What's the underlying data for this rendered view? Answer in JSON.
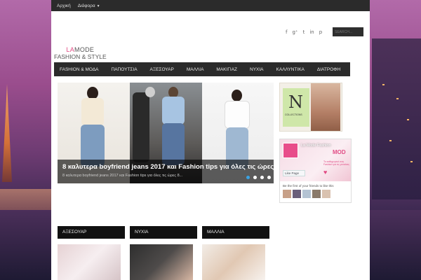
{
  "topbar": {
    "items": [
      "Αρχική",
      "Διάφορα"
    ]
  },
  "header": {
    "logo_line1_a": "LA",
    "logo_line1_b": "MODE",
    "logo_line2": "FASHION & STYLE",
    "social_icons": [
      "facebook-icon",
      "google-plus-icon",
      "twitter-icon",
      "linkedin-icon",
      "pinterest-icon"
    ],
    "social_glyphs": [
      "f",
      "g⁺",
      "t",
      "in",
      "p"
    ],
    "search_placeholder": "SEARCH..."
  },
  "nav": {
    "items": [
      "FASHION & ΜΟΔΑ",
      "ΠΑΠΟΥΤΣΙΑ",
      "ΑΞΕΣΟΥΑΡ",
      "ΜΑΛΛΙΑ",
      "ΜΑΚΙΓΙΑΖ",
      "ΝΥΧΙΑ",
      "ΚΑΛΛΥΝΤΙΚΑ",
      "ΔΙΑΤΡΟΦΗ"
    ]
  },
  "slider": {
    "title": "8 καλυτερα boyfriend jeans 2017 και Fashion tips για όλες τις ώρες",
    "excerpt": "8 καλυτερα boyfriend jeans 2017 και Fashion tips για όλες τις ώρες  8...",
    "dots": 4,
    "active_dot": 0
  },
  "ad": {
    "letter": "N",
    "collection": "COLLECTIONS"
  },
  "facebook": {
    "page_name": "La Mode Fashion",
    "brand": "MOD",
    "tagline": "Το καθημερινό σας Fashion για τις γυναίκες",
    "like_label": "Like Page",
    "friends_text": "Be the first of your friends to like this"
  },
  "categories": [
    "ΑΞΕΣΟΥΑΡ",
    "ΝΥΧΙΑ",
    "ΜΑΛΛΙΑ"
  ],
  "colors": {
    "accent": "#e14b84",
    "dark": "#2b2b2b",
    "active_dot": "#3aa3e3"
  }
}
